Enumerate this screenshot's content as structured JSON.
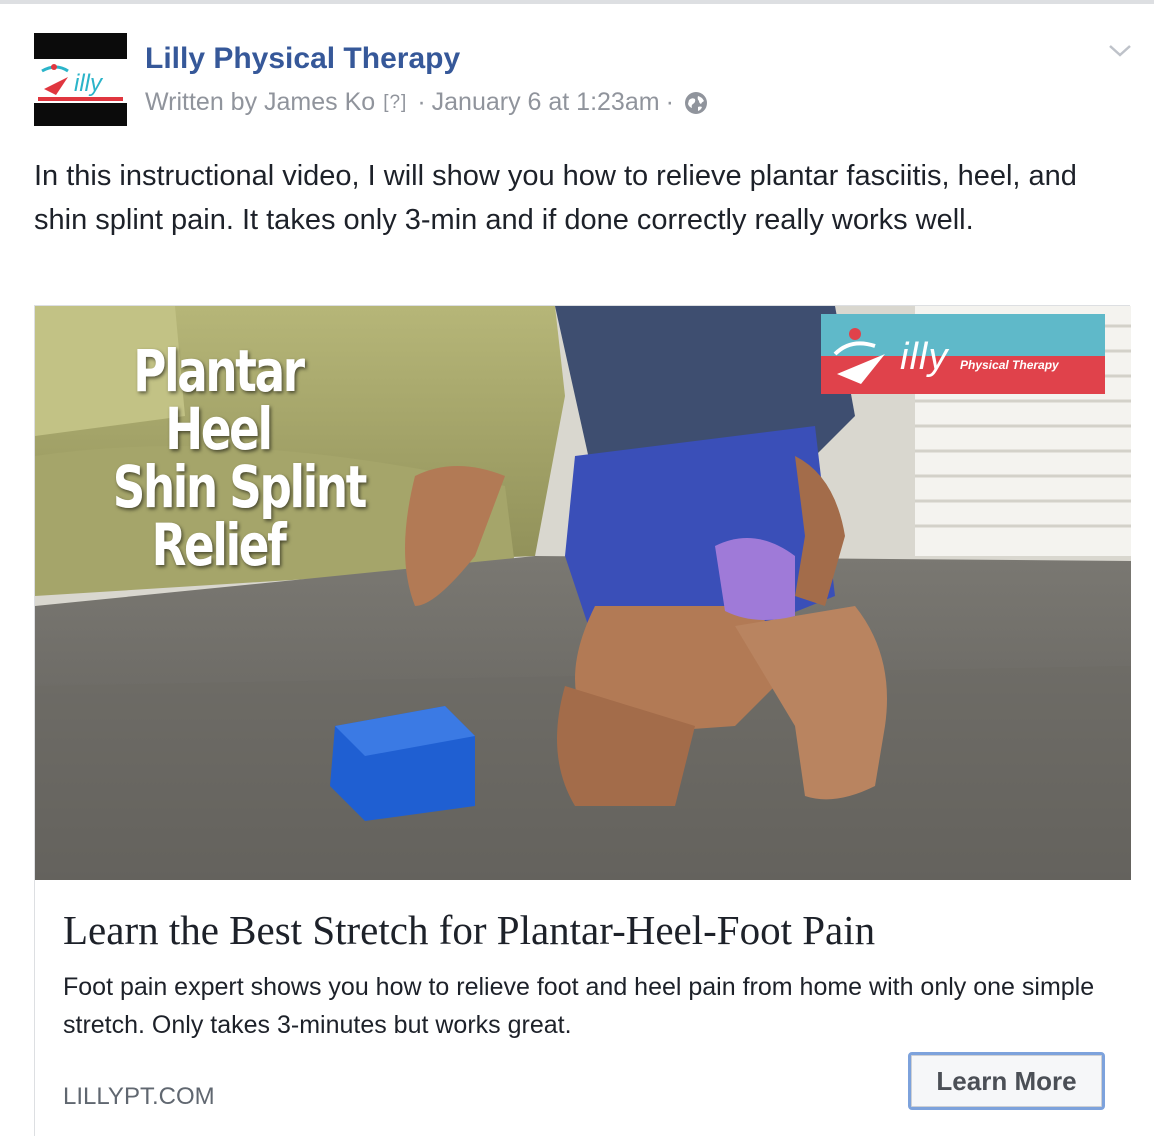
{
  "post": {
    "page_name": "Lilly Physical Therapy",
    "author_text": "Written by James Ko",
    "help_marker": "[?]",
    "separator": "·",
    "timestamp": "January 6 at 1:23am",
    "privacy_icon": "globe-icon",
    "menu_icon": "chevron-down-icon",
    "message": "In this instructional video, I will show you how to relieve plantar fasciitis, heel, and shin splint pain. It takes only 3-min and if done correctly really works well."
  },
  "attachment": {
    "video_overlay_lines": [
      "Plantar",
      "Heel",
      "Shin Splint",
      "Relief"
    ],
    "brand_logo_text": "illy",
    "brand_logo_subtext": "Physical Therapy",
    "headline": "Learn the Best Stretch for Plantar-Heel-Foot Pain",
    "description": "Foot pain expert shows you how to relieve foot and heel pain from home with only one simple stretch. Only takes 3-minutes but works great.",
    "domain": "LILLYPT.COM",
    "cta_label": "Learn More"
  },
  "colors": {
    "page_name": "#365899",
    "meta": "#90949c",
    "text": "#1d2129",
    "border": "#dddfe2",
    "cta_border": "#7da2dc"
  }
}
